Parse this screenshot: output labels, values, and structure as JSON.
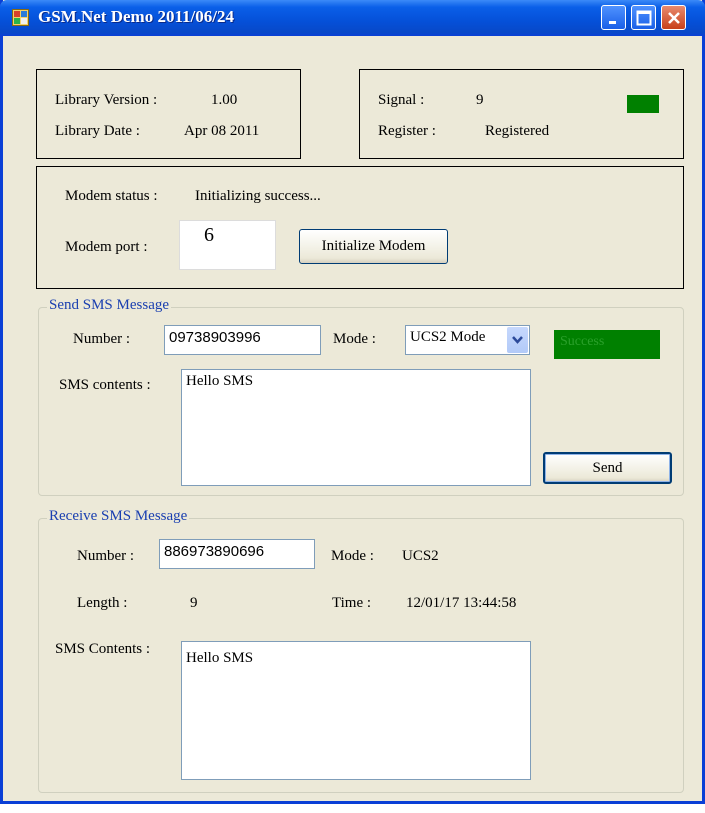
{
  "window": {
    "title": "GSM.Net Demo 2011/06/24"
  },
  "library": {
    "version_label": "Library Version :",
    "version_value": "1.00",
    "date_label": "Library Date :",
    "date_value": "Apr 08 2011"
  },
  "signal": {
    "signal_label": "Signal :",
    "signal_value": "9",
    "register_label": "Register :",
    "register_value": "Registered",
    "indicator_color": "#008000"
  },
  "modem": {
    "status_label": "Modem status :",
    "status_value": "Initializing success...",
    "port_label": "Modem port :",
    "port_value": "6",
    "init_button": "Initialize Modem"
  },
  "send": {
    "group_title": "Send SMS Message",
    "number_label": "Number :",
    "number_value": "09738903996",
    "mode_label": "Mode :",
    "mode_value": "UCS2 Mode",
    "status_text": "Success",
    "status_color": "#008000",
    "contents_label": "SMS contents :",
    "contents_value": "Hello SMS",
    "send_button": "Send"
  },
  "receive": {
    "group_title": "Receive SMS Message",
    "number_label": "Number :",
    "number_value": "886973890696",
    "mode_label": "Mode :",
    "mode_value": "UCS2",
    "length_label": "Length :",
    "length_value": "9",
    "time_label": "Time :",
    "time_value": "12/01/17 13:44:58",
    "contents_label": "SMS Contents :",
    "contents_value": "Hello SMS"
  }
}
